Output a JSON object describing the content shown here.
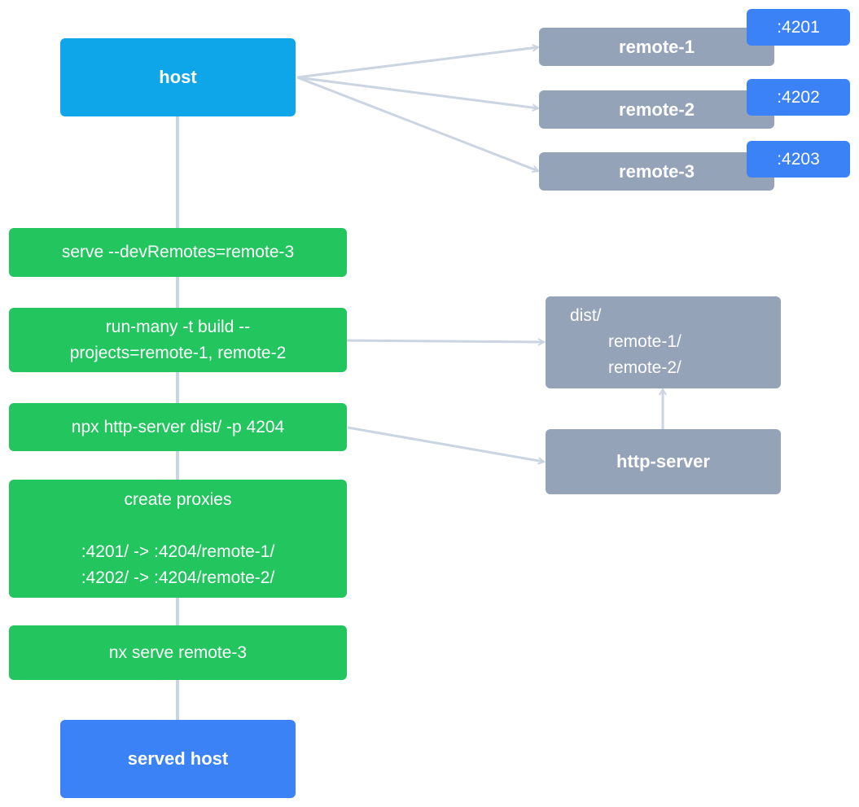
{
  "colors": {
    "host": "#0ea5e9",
    "served_host": "#3b82f6",
    "step": "#22c55e",
    "remote": "#94a3b8",
    "port_badge": "#3b82f6",
    "edge": "#cbd5e1"
  },
  "host": {
    "label": "host"
  },
  "remotes": [
    {
      "label": "remote-1",
      "port": ":4201"
    },
    {
      "label": "remote-2",
      "port": ":4202"
    },
    {
      "label": "remote-3",
      "port": ":4203"
    }
  ],
  "steps": [
    {
      "lines": [
        "serve --devRemotes=remote-3"
      ]
    },
    {
      "lines": [
        "run-many -t build --",
        "projects=remote-1, remote-2"
      ]
    },
    {
      "lines": [
        "npx http-server dist/ -p 4204"
      ]
    },
    {
      "title": "create proxies",
      "lines": [
        ":4201/ -> :4204/remote-1/",
        ":4202/ -> :4204/remote-2/"
      ]
    },
    {
      "lines": [
        "nx serve remote-3"
      ]
    }
  ],
  "dist": {
    "root": "dist/",
    "children": [
      "remote-1/",
      "remote-2/"
    ]
  },
  "http_server": {
    "label": "http-server"
  },
  "served_host": {
    "label": "served host"
  }
}
